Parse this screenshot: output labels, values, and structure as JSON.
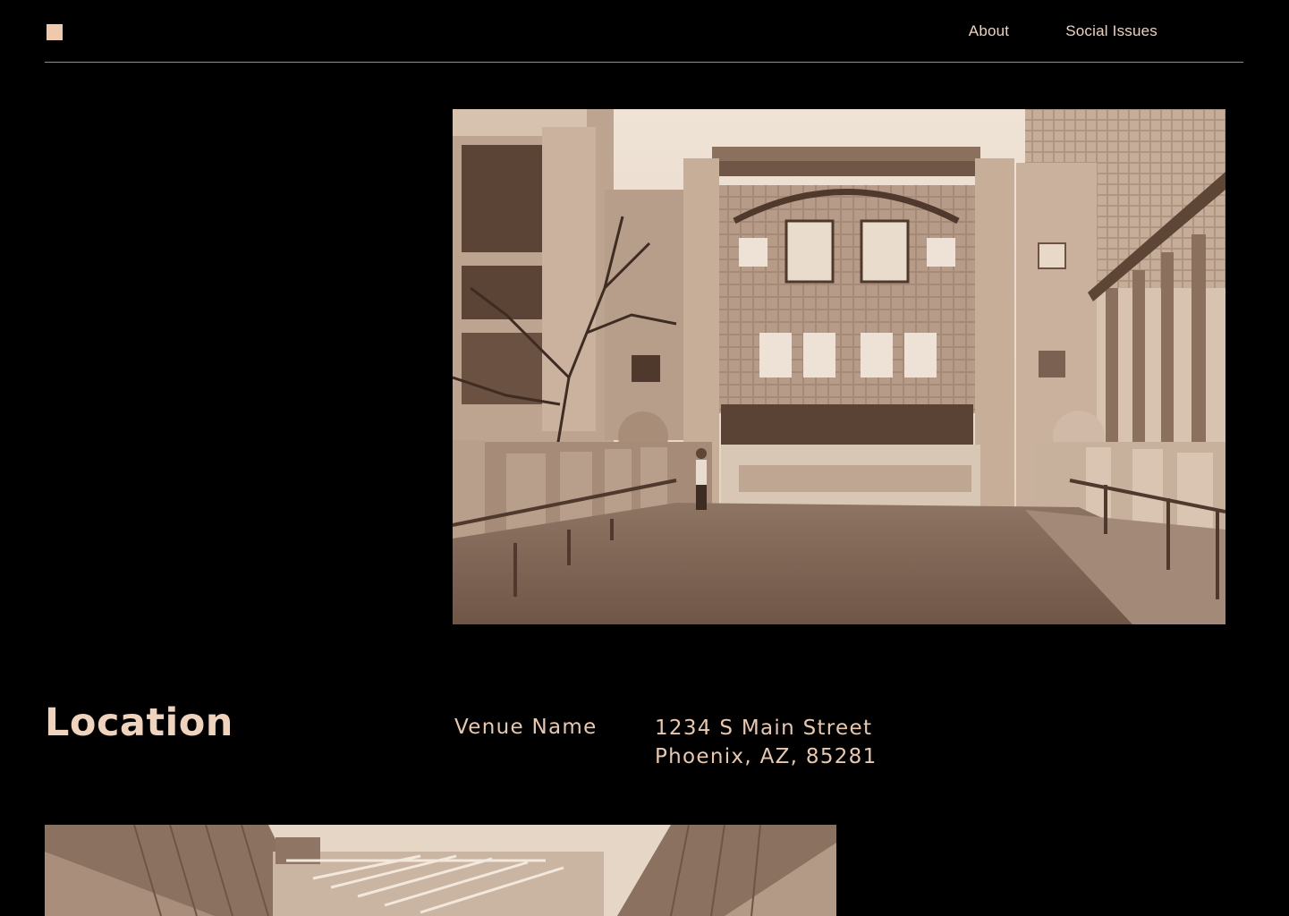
{
  "nav": {
    "logo_icon": "square-logo-icon",
    "links": [
      "About",
      "Social Issues"
    ]
  },
  "hero": {
    "description_icon": "building-photo"
  },
  "location": {
    "title": "Location",
    "venue": "Venue Name",
    "address_line1": "1234 S Main Street",
    "address_line2": "Phoenix, AZ, 85281"
  },
  "colors": {
    "background": "#000000",
    "accent": "#efc9ae",
    "text": "#e9c8ad",
    "divider": "#a8877a"
  }
}
